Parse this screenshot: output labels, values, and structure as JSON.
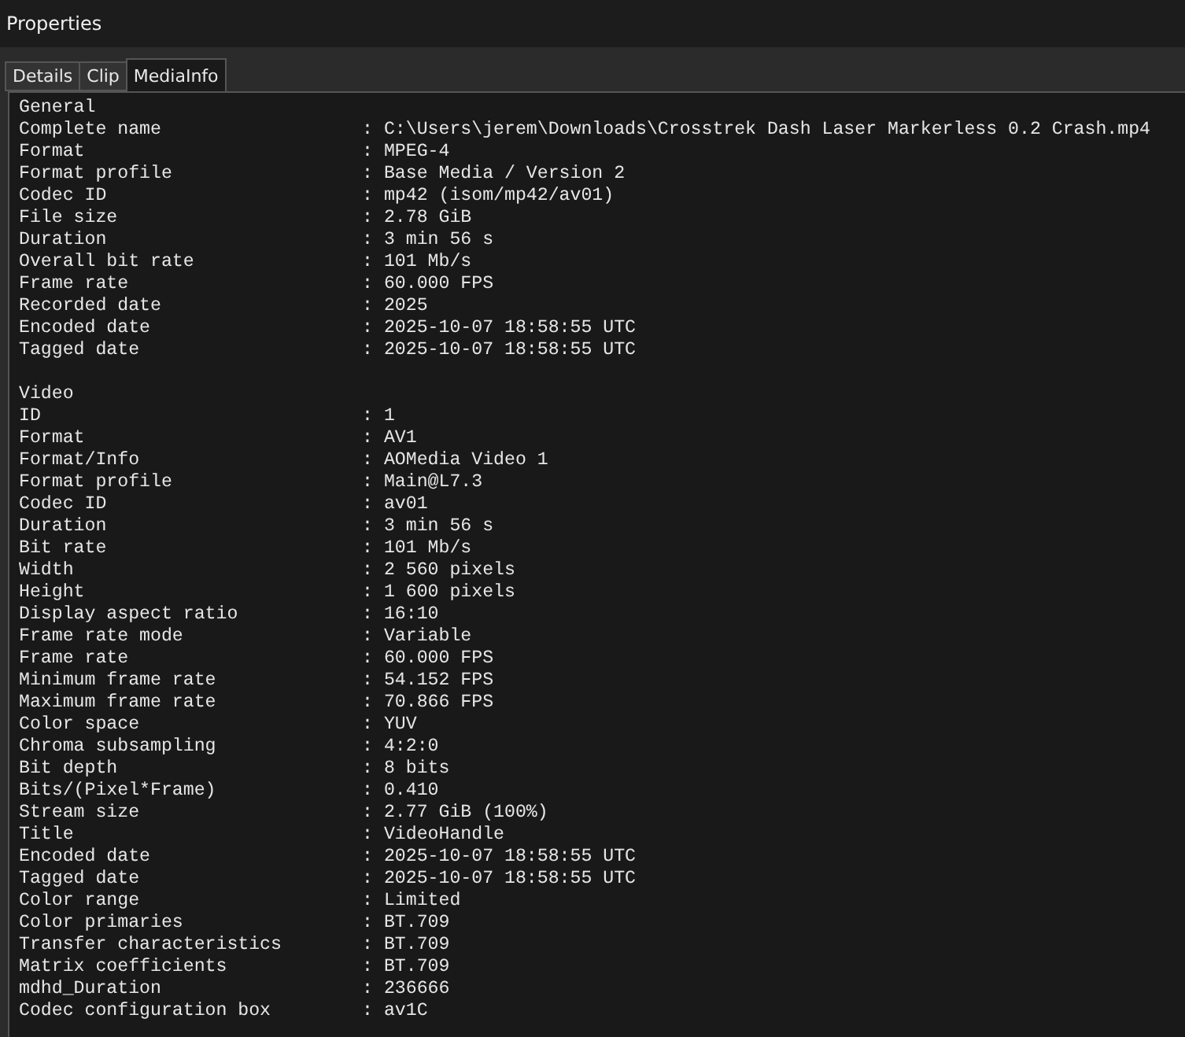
{
  "window": {
    "title": "Properties"
  },
  "tabs": [
    {
      "label": "Details",
      "selected": false
    },
    {
      "label": "Clip",
      "selected": false
    },
    {
      "label": "MediaInfo",
      "selected": true
    }
  ],
  "separator": ":",
  "sections": [
    {
      "title": "General",
      "rows": [
        {
          "label": "Complete name",
          "value": "C:\\Users\\jerem\\Downloads\\Crosstrek Dash Laser Markerless 0.2 Crash.mp4"
        },
        {
          "label": "Format",
          "value": "MPEG-4"
        },
        {
          "label": "Format profile",
          "value": "Base Media / Version 2"
        },
        {
          "label": "Codec ID",
          "value": "mp42 (isom/mp42/av01)"
        },
        {
          "label": "File size",
          "value": "2.78 GiB"
        },
        {
          "label": "Duration",
          "value": "3 min 56 s"
        },
        {
          "label": "Overall bit rate",
          "value": "101 Mb/s"
        },
        {
          "label": "Frame rate",
          "value": "60.000 FPS"
        },
        {
          "label": "Recorded date",
          "value": "2025"
        },
        {
          "label": "Encoded date",
          "value": "2025-10-07 18:58:55 UTC"
        },
        {
          "label": "Tagged date",
          "value": "2025-10-07 18:58:55 UTC"
        }
      ]
    },
    {
      "title": "Video",
      "rows": [
        {
          "label": "ID",
          "value": "1"
        },
        {
          "label": "Format",
          "value": "AV1"
        },
        {
          "label": "Format/Info",
          "value": "AOMedia Video 1"
        },
        {
          "label": "Format profile",
          "value": "Main@L7.3"
        },
        {
          "label": "Codec ID",
          "value": "av01"
        },
        {
          "label": "Duration",
          "value": "3 min 56 s"
        },
        {
          "label": "Bit rate",
          "value": "101 Mb/s"
        },
        {
          "label": "Width",
          "value": "2 560 pixels"
        },
        {
          "label": "Height",
          "value": "1 600 pixels"
        },
        {
          "label": "Display aspect ratio",
          "value": "16:10"
        },
        {
          "label": "Frame rate mode",
          "value": "Variable"
        },
        {
          "label": "Frame rate",
          "value": "60.000 FPS"
        },
        {
          "label": "Minimum frame rate",
          "value": "54.152 FPS"
        },
        {
          "label": "Maximum frame rate",
          "value": "70.866 FPS"
        },
        {
          "label": "Color space",
          "value": "YUV"
        },
        {
          "label": "Chroma subsampling",
          "value": "4:2:0"
        },
        {
          "label": "Bit depth",
          "value": "8 bits"
        },
        {
          "label": "Bits/(Pixel*Frame)",
          "value": "0.410"
        },
        {
          "label": "Stream size",
          "value": "2.77 GiB (100%)"
        },
        {
          "label": "Title",
          "value": "VideoHandle"
        },
        {
          "label": "Encoded date",
          "value": "2025-10-07 18:58:55 UTC"
        },
        {
          "label": "Tagged date",
          "value": "2025-10-07 18:58:55 UTC"
        },
        {
          "label": "Color range",
          "value": "Limited"
        },
        {
          "label": "Color primaries",
          "value": "BT.709"
        },
        {
          "label": "Transfer characteristics",
          "value": "BT.709"
        },
        {
          "label": "Matrix coefficients",
          "value": "BT.709"
        },
        {
          "label": "mdhd_Duration",
          "value": "236666"
        },
        {
          "label": "Codec configuration box",
          "value": "av1C"
        }
      ]
    }
  ]
}
